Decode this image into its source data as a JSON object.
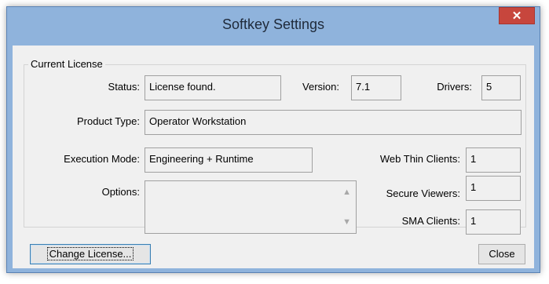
{
  "window": {
    "title": "Softkey Settings",
    "close_glyph": "✕"
  },
  "license": {
    "group_title": "Current License",
    "status_label": "Status:",
    "status_value": "License found.",
    "version_label": "Version:",
    "version_value": "7.1",
    "drivers_label": "Drivers:",
    "drivers_value": "5",
    "product_type_label": "Product Type:",
    "product_type_value": "Operator Workstation",
    "execution_mode_label": "Execution Mode:",
    "execution_mode_value": "Engineering + Runtime",
    "web_thin_clients_label": "Web Thin Clients:",
    "web_thin_clients_value": "1",
    "options_label": "Options:",
    "options_value": "",
    "secure_viewers_label": "Secure Viewers:",
    "secure_viewers_value": "1",
    "sma_clients_label": "SMA Clients:",
    "sma_clients_value": "1"
  },
  "buttons": {
    "change_license": "Change License...",
    "close": "Close"
  },
  "icons": {
    "scroll_up": "chevron-up-icon",
    "scroll_down": "chevron-down-icon"
  }
}
